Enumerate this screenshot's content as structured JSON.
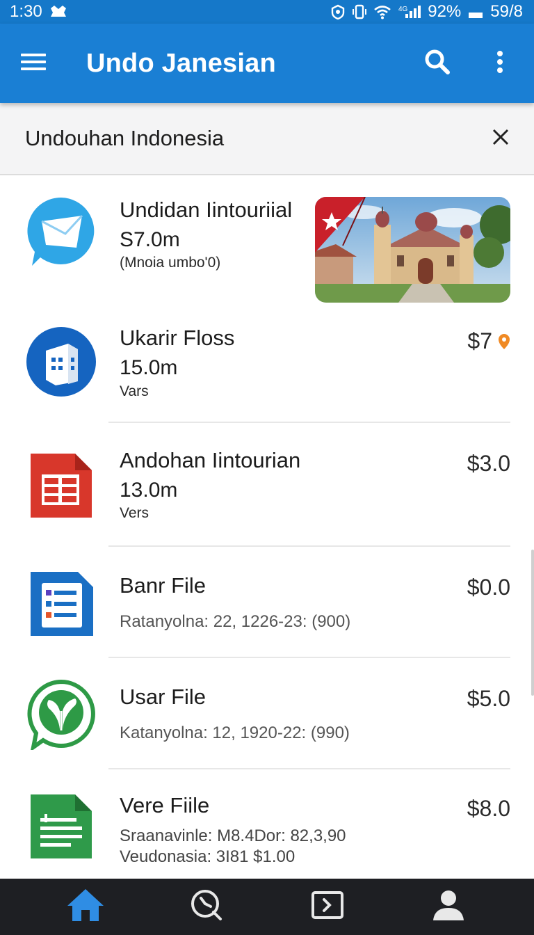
{
  "status_bar": {
    "time": "1:30",
    "battery_percent": "92%",
    "extra": "59/8",
    "icons": [
      "app-notification-icon",
      "shield-icon",
      "vibrate-icon",
      "wifi-icon",
      "signal-icon",
      "battery-icon"
    ]
  },
  "app_bar": {
    "title": "Undo Janesian",
    "menu_icon": "hamburger-menu-icon",
    "search_icon": "search-icon",
    "more_icon": "more-vert-icon"
  },
  "sub_header": {
    "title": "Undouhan Indonesia",
    "close_icon": "close-icon"
  },
  "items": [
    {
      "icon": "mail-chat-icon",
      "title": "Undidan Iintouriial",
      "size": "S7.0m",
      "sub": "(Mnoia umbo'0)",
      "thumbnail": "church-photo"
    },
    {
      "icon": "building-icon",
      "title": "Ukarir Floss",
      "size": "15.0m",
      "sub": "Vars",
      "price": "$7",
      "badge_color": "#f08a24"
    },
    {
      "icon": "spreadsheet-red-icon",
      "title": "Andohan Iintourian",
      "size": "13.0m",
      "sub": "Vers",
      "price": "$3.0"
    },
    {
      "icon": "document-list-icon",
      "title": "Banr File",
      "meta": "Ratanyolna: 22, 1226-23: (900)",
      "price": "$0.0"
    },
    {
      "icon": "leaf-chat-icon",
      "title": "Usar File",
      "meta": "Katanyolna: 12, 1920-22: (990)",
      "price": "$5.0"
    },
    {
      "icon": "green-sheet-icon",
      "title": "Vere Fiile",
      "meta": "Sraanavinle: M8.4Dor: 82,3,90",
      "meta2": "Veudonasia: 3I81 $1.00",
      "price": "$8.0"
    }
  ],
  "bottom_nav": {
    "items": [
      "home-icon",
      "history-icon",
      "media-icon",
      "profile-icon"
    ],
    "active_color": "#2f8de4"
  },
  "colors": {
    "primary": "#1a7fd4",
    "status_bar": "#1578c9"
  }
}
